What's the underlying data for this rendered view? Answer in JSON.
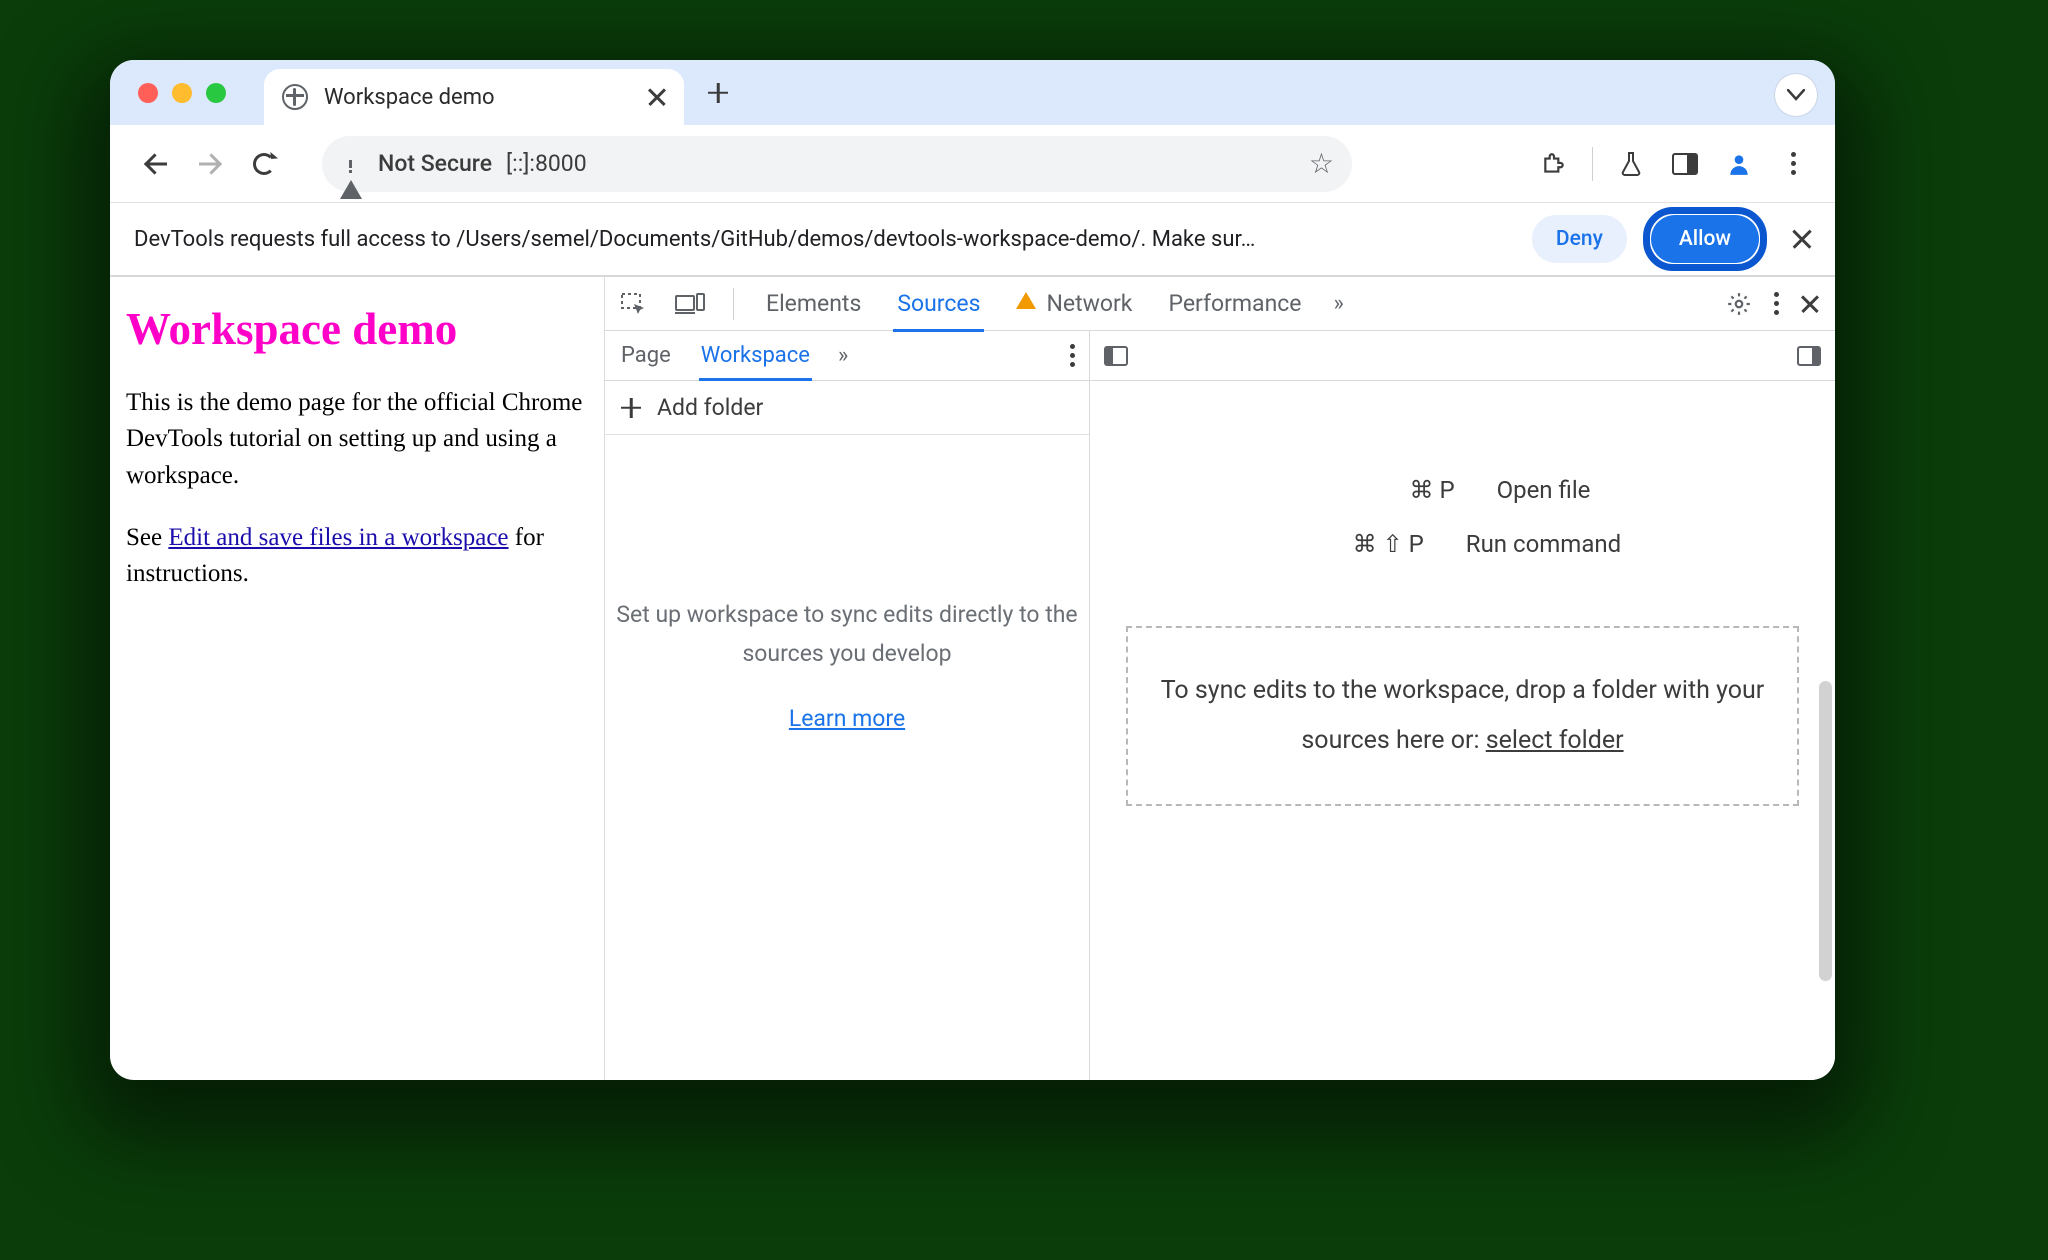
{
  "tab": {
    "title": "Workspace demo"
  },
  "omnibox": {
    "security_label": "Not Secure",
    "url": "[::]:8000"
  },
  "infobar": {
    "message": "DevTools requests full access to /Users/semel/Documents/GitHub/demos/devtools-workspace-demo/. Make sur…",
    "deny": "Deny",
    "allow": "Allow"
  },
  "page": {
    "heading": "Workspace demo",
    "p1": "This is the demo page for the official Chrome DevTools tutorial on setting up and using a workspace.",
    "p2_pre": "See ",
    "p2_link": "Edit and save files in a workspace",
    "p2_post": " for instructions."
  },
  "devtools": {
    "tabs": {
      "elements": "Elements",
      "sources": "Sources",
      "network": "Network",
      "performance": "Performance"
    },
    "subtabs": {
      "page": "Page",
      "workspace": "Workspace"
    },
    "add_folder": "Add folder",
    "workspace_help": "Set up workspace to sync edits directly to the sources you develop",
    "learn_more": "Learn more",
    "shortcuts": {
      "open_file_key": "⌘ P",
      "open_file_label": "Open file",
      "run_cmd_key": "⌘ ⇧ P",
      "run_cmd_label": "Run command"
    },
    "dropzone": {
      "text": "To sync edits to the workspace, drop a folder with your sources here or: ",
      "select_folder": "select folder"
    }
  }
}
